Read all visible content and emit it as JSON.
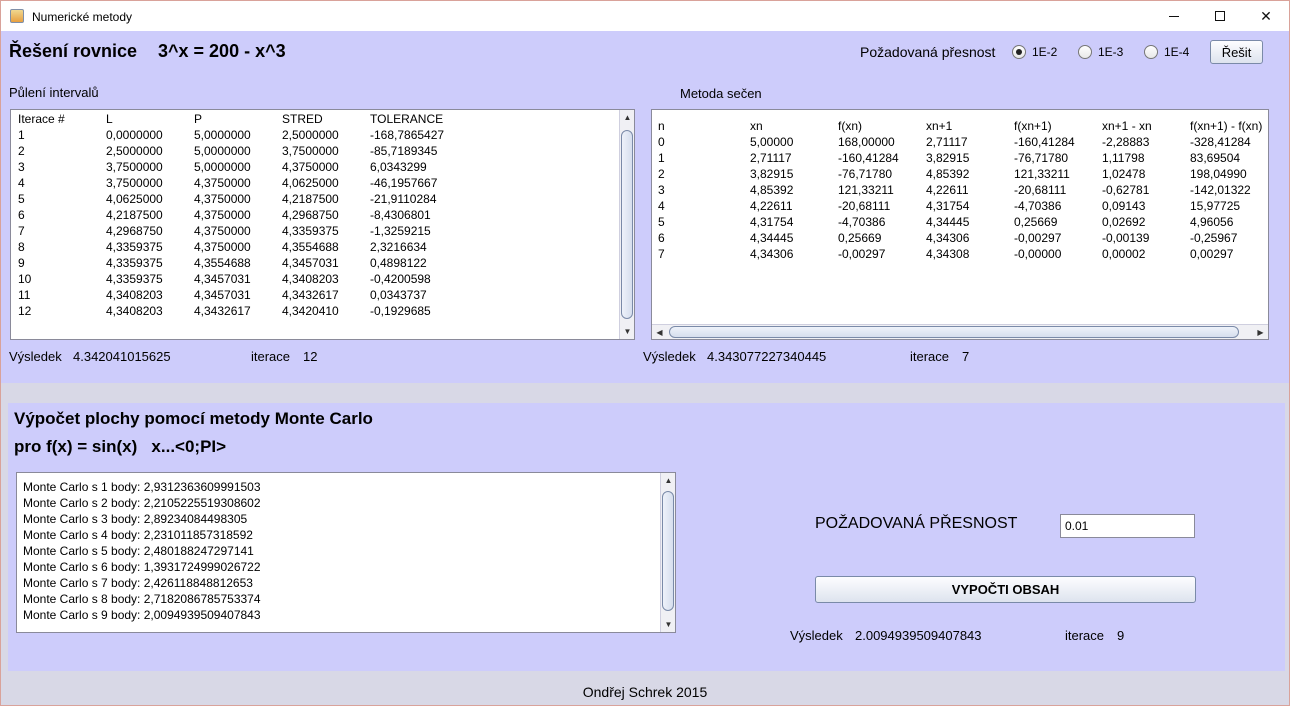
{
  "window": {
    "title": "Numerické metody"
  },
  "equation": {
    "heading": "Řešení rovnice",
    "formula": "3^x = 200 - x^3",
    "precision_label": "Požadovaná přesnost",
    "options": [
      {
        "label": "1E-2",
        "checked": true
      },
      {
        "label": "1E-3",
        "checked": false
      },
      {
        "label": "1E-4",
        "checked": false
      }
    ],
    "solve_button": "Řešit"
  },
  "bisection": {
    "title": "Půlení intervalů",
    "columns": [
      "Iterace #",
      "L",
      "P",
      "STRED",
      "TOLERANCE"
    ],
    "rows": [
      [
        "1",
        "0,0000000",
        "5,0000000",
        "2,5000000",
        "-168,7865427"
      ],
      [
        "2",
        "2,5000000",
        "5,0000000",
        "3,7500000",
        "-85,7189345"
      ],
      [
        "3",
        "3,7500000",
        "5,0000000",
        "4,3750000",
        "6,0343299"
      ],
      [
        "4",
        "3,7500000",
        "4,3750000",
        "4,0625000",
        "-46,1957667"
      ],
      [
        "5",
        "4,0625000",
        "4,3750000",
        "4,2187500",
        "-21,9110284"
      ],
      [
        "6",
        "4,2187500",
        "4,3750000",
        "4,2968750",
        "-8,4306801"
      ],
      [
        "7",
        "4,2968750",
        "4,3750000",
        "4,3359375",
        "-1,3259215"
      ],
      [
        "8",
        "4,3359375",
        "4,3750000",
        "4,3554688",
        "2,3216634"
      ],
      [
        "9",
        "4,3359375",
        "4,3554688",
        "4,3457031",
        "0,4898122"
      ],
      [
        "10",
        "4,3359375",
        "4,3457031",
        "4,3408203",
        "-0,4200598"
      ],
      [
        "11",
        "4,3408203",
        "4,3457031",
        "4,3432617",
        "0,0343737"
      ],
      [
        "12",
        "4,3408203",
        "4,3432617",
        "4,3420410",
        "-0,1929685"
      ]
    ],
    "result_label": "Výsledek",
    "result_value": "4.342041015625",
    "iter_label": "iterace",
    "iter_value": "12"
  },
  "secant": {
    "title": "Metoda sečen",
    "columns": [
      "n",
      "xn",
      "f(xn)",
      "xn+1",
      "f(xn+1)",
      "xn+1 - xn",
      "f(xn+1) - f(xn)"
    ],
    "rows": [
      [
        "0",
        "5,00000",
        "168,00000",
        "2,71117",
        "-160,41284",
        "-2,28883",
        "-328,41284"
      ],
      [
        "1",
        "2,71117",
        "-160,41284",
        "3,82915",
        "-76,71780",
        "1,11798",
        "83,69504"
      ],
      [
        "2",
        "3,82915",
        "-76,71780",
        "4,85392",
        "121,33211",
        "1,02478",
        "198,04990"
      ],
      [
        "3",
        "4,85392",
        "121,33211",
        "4,22611",
        "-20,68111",
        "-0,62781",
        "-142,01322"
      ],
      [
        "4",
        "4,22611",
        "-20,68111",
        "4,31754",
        "-4,70386",
        "0,09143",
        "15,97725"
      ],
      [
        "5",
        "4,31754",
        "-4,70386",
        "4,34445",
        "0,25669",
        "0,02692",
        "4,96056"
      ],
      [
        "6",
        "4,34445",
        "0,25669",
        "4,34306",
        "-0,00297",
        "-0,00139",
        "-0,25967"
      ],
      [
        "7",
        "4,34306",
        "-0,00297",
        "4,34308",
        "-0,00000",
        "0,00002",
        "0,00297"
      ]
    ],
    "result_label": "Výsledek",
    "result_value": "4.343077227340445",
    "iter_label": "iterace",
    "iter_value": "7"
  },
  "montecarlo": {
    "title": "Výpočet plochy pomocí metody Monte Carlo",
    "subtitle": "pro f(x) = sin(x)   x...<0;PI>",
    "lines": [
      "Monte Carlo s 1 body: 2,9312363609991503",
      "Monte Carlo s 2 body: 2,2105225519308602",
      "Monte Carlo s 3 body: 2,89234084498305",
      "Monte Carlo s 4 body: 2,231011857318592",
      "Monte Carlo s 5 body: 2,480188247297141",
      "Monte Carlo s 6 body: 1,3931724999026722",
      "Monte Carlo s 7 body: 2,426118848812653",
      "Monte Carlo s 8 body: 2,7182086785753374",
      "Monte Carlo s 9 body: 2,0094939509407843"
    ],
    "precision_label": "POŽADOVANÁ PŘESNOST",
    "precision_value": "0.01",
    "compute_button": "VYPOČTI OBSAH",
    "result_label": "Výsledek",
    "result_value": "2.0094939509407843",
    "iter_label": "iterace",
    "iter_value": "9"
  },
  "footer": {
    "text": "Ondřej Schrek 2015"
  }
}
